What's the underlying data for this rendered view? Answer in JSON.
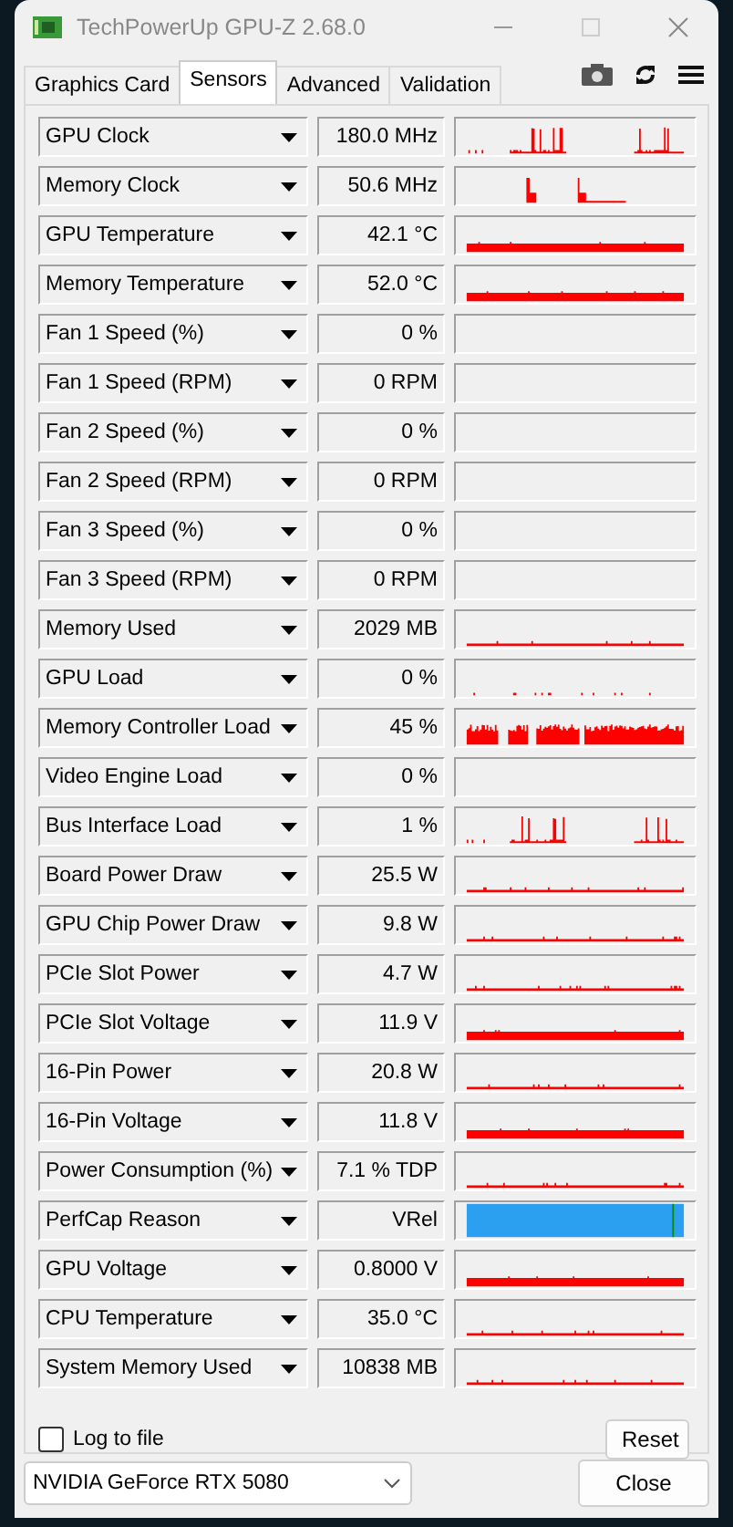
{
  "window": {
    "title": "TechPowerUp GPU-Z 2.68.0"
  },
  "tabs": [
    {
      "label": "Graphics Card",
      "selected": false
    },
    {
      "label": "Sensors",
      "selected": true
    },
    {
      "label": "Advanced",
      "selected": false
    },
    {
      "label": "Validation",
      "selected": false
    }
  ],
  "sensors": [
    {
      "name": "GPU Clock",
      "value": "180.0 MHz",
      "kind": "spiky"
    },
    {
      "name": "Memory Clock",
      "value": "50.6 MHz",
      "kind": "bursts"
    },
    {
      "name": "GPU Temperature",
      "value": "42.1 °C",
      "kind": "thick"
    },
    {
      "name": "Memory Temperature",
      "value": "52.0 °C",
      "kind": "thick"
    },
    {
      "name": "Fan 1 Speed (%)",
      "value": "0 %",
      "kind": "empty"
    },
    {
      "name": "Fan 1 Speed (RPM)",
      "value": "0 RPM",
      "kind": "empty"
    },
    {
      "name": "Fan 2 Speed (%)",
      "value": "0 %",
      "kind": "empty"
    },
    {
      "name": "Fan 2 Speed (RPM)",
      "value": "0 RPM",
      "kind": "empty"
    },
    {
      "name": "Fan 3 Speed (%)",
      "value": "0 %",
      "kind": "empty"
    },
    {
      "name": "Fan 3 Speed (RPM)",
      "value": "0 RPM",
      "kind": "empty"
    },
    {
      "name": "Memory Used",
      "value": "2029 MB",
      "kind": "line"
    },
    {
      "name": "GPU Load",
      "value": "0 %",
      "kind": "sparse"
    },
    {
      "name": "Memory Controller Load",
      "value": "45 %",
      "kind": "dense"
    },
    {
      "name": "Video Engine Load",
      "value": "0 %",
      "kind": "empty"
    },
    {
      "name": "Bus Interface Load",
      "value": "1 %",
      "kind": "spiky"
    },
    {
      "name": "Board Power Draw",
      "value": "25.5 W",
      "kind": "line"
    },
    {
      "name": "GPU Chip Power Draw",
      "value": "9.8 W",
      "kind": "line"
    },
    {
      "name": "PCIe Slot Power",
      "value": "4.7 W",
      "kind": "line"
    },
    {
      "name": "PCIe Slot Voltage",
      "value": "11.9 V",
      "kind": "thick"
    },
    {
      "name": "16-Pin Power",
      "value": "20.8 W",
      "kind": "line"
    },
    {
      "name": "16-Pin Voltage",
      "value": "11.8 V",
      "kind": "thick"
    },
    {
      "name": "Power Consumption (%)",
      "value": "7.1 % TDP",
      "kind": "line"
    },
    {
      "name": "PerfCap Reason",
      "value": "VRel",
      "kind": "perfcap"
    },
    {
      "name": "GPU Voltage",
      "value": "0.8000 V",
      "kind": "thick"
    },
    {
      "name": "CPU Temperature",
      "value": "35.0 °C",
      "kind": "line"
    },
    {
      "name": "System Memory Used",
      "value": "10838 MB",
      "kind": "line"
    }
  ],
  "log_to_file": {
    "label": "Log to file",
    "checked": false
  },
  "reset_button": "Reset",
  "device": "NVIDIA GeForce RTX 5080",
  "close_button": "Close"
}
